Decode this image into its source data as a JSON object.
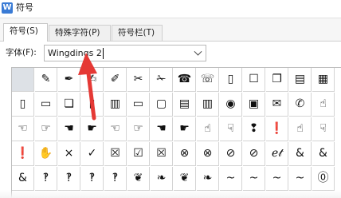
{
  "window": {
    "title": "符号",
    "app_icon_glyph": "W",
    "accent": "#3a7bd5"
  },
  "tabs": [
    {
      "label": "符号(S)",
      "active": true
    },
    {
      "label": "特殊字符(P)",
      "active": false
    },
    {
      "label": "符号栏(T)",
      "active": false
    }
  ],
  "font": {
    "label": "字体(F):",
    "value": "Wingdings 2"
  },
  "symbols": [
    [
      "",
      "✎",
      "✒",
      "✍",
      "✐",
      "✂",
      "✁",
      "☎",
      "☏",
      "▯",
      "☐",
      "❐",
      "▤",
      "▦"
    ],
    [
      "▯",
      "▭",
      "❏",
      "▮",
      "▥",
      "▭",
      "▢",
      "▤",
      "▥",
      "◉",
      "▣",
      "✉",
      "✆",
      "☝"
    ],
    [
      "☜",
      "☞",
      "☚",
      "☛",
      "☜",
      "☞",
      "☚",
      "☛",
      "☝",
      "☟",
      "❢",
      "❗",
      "☝",
      "☟"
    ],
    [
      "❗",
      "✋",
      "×",
      "✓",
      "☒",
      "☑",
      "☒",
      "⊗",
      "⊗",
      "⊘",
      "⊘",
      "ℯ𝓉",
      "&",
      "&"
    ],
    [
      "&",
      "‽",
      "‽",
      "‽",
      "‽",
      "❦",
      "❧",
      "❦",
      "❧",
      "~",
      "~",
      "~",
      "~",
      "⓪"
    ]
  ],
  "selected_cell": [
    0,
    0
  ],
  "annotation_color": "#e53935"
}
